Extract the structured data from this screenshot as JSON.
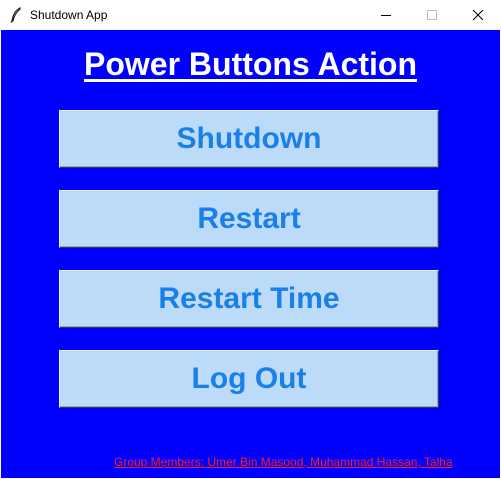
{
  "window": {
    "title": "Shutdown App",
    "controls": {
      "minimize_icon": "minimize-icon",
      "maximize_icon": "maximize-icon",
      "close_icon": "close-icon"
    }
  },
  "main": {
    "heading": "Power Buttons Action",
    "buttons": [
      {
        "label": "Shutdown"
      },
      {
        "label": "Restart"
      },
      {
        "label": "Restart Time"
      },
      {
        "label": "Log Out"
      }
    ],
    "group_members": "Group Members: Umer Bin Masood, Muhammad Hassan, Talha"
  },
  "colors": {
    "background": "#0000ff",
    "button_bg": "#bbdbf8",
    "button_text": "#1a7fe6",
    "heading_text": "#ffffff",
    "members_text": "#ff1a1a"
  }
}
